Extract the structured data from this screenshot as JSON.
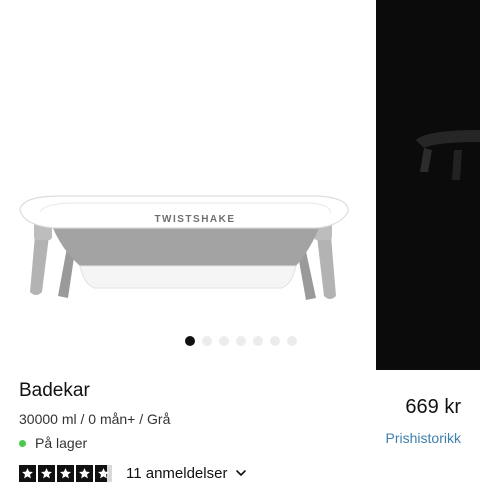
{
  "product": {
    "title": "Badekar",
    "variant": "30000 ml / 0 mån+ / Grå",
    "stock_status": "På lager",
    "price": "669 kr",
    "price_history_link": "Prishistorikk",
    "brand_print": "TWISTSHAKE",
    "rating": {
      "stars": 4.7,
      "max": 5,
      "reviews_label": "11 anmeldelser"
    }
  },
  "gallery": {
    "image_count": 7,
    "active_index": 0
  },
  "colors": {
    "stock_dot": "#4cc94c",
    "link": "#3d7fae",
    "active_dot": "#111111",
    "inactive_dot": "#ececec",
    "tub_grey": "#a3a3a3"
  },
  "icons": {
    "stock": "green-dot-icon",
    "review_toggle": "chevron-down-icon",
    "star": "star-icon"
  }
}
